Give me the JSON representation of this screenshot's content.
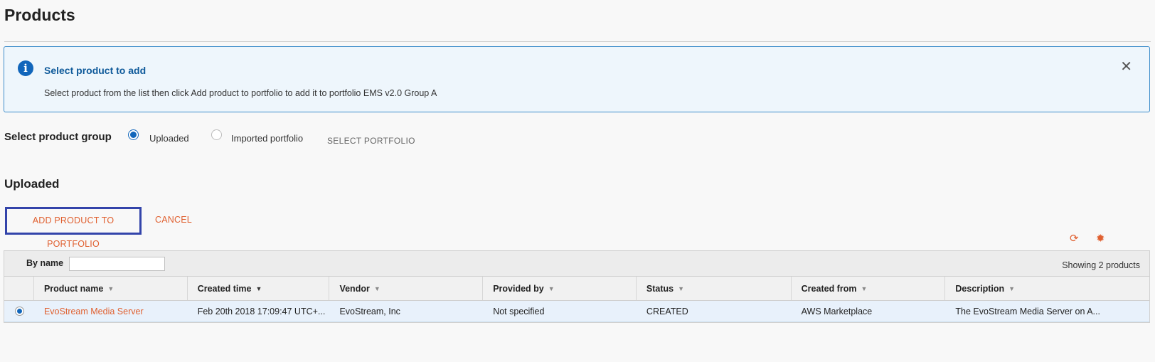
{
  "page": {
    "title": "Products"
  },
  "info": {
    "title": "Select product to add",
    "text": "Select product from the list then click Add product to portfolio to add it to portfolio EMS v2.0 Group A",
    "icon": "info-icon",
    "close_icon": "close-icon"
  },
  "product_group": {
    "label": "Select product group",
    "options": [
      {
        "label": "Uploaded",
        "selected": true
      },
      {
        "label": "Imported portfolio",
        "selected": false
      }
    ],
    "select_portfolio_label": "SELECT PORTFOLIO"
  },
  "section": {
    "title": "Uploaded"
  },
  "actions": {
    "add_label": "ADD PRODUCT TO PORTFOLIO",
    "cancel_label": "CANCEL"
  },
  "toolbar": {
    "refresh_icon": "refresh-icon",
    "settings_icon": "gear-icon"
  },
  "table": {
    "filter_label": "By name",
    "filter_value": "",
    "showing": "Showing 2 products",
    "columns": [
      "Product name",
      "Created time",
      "Vendor",
      "Provided by",
      "Status",
      "Created from",
      "Description"
    ],
    "rows": [
      {
        "selected": true,
        "product_name": "EvoStream Media Server",
        "created_time": "Feb 20th 2018 17:09:47 UTC+...",
        "vendor": "EvoStream, Inc",
        "provided_by": "Not specified",
        "status": "CREATED",
        "created_from": "AWS Marketplace",
        "description": "The EvoStream Media Server on A..."
      }
    ]
  },
  "colors": {
    "accent": "#e06030",
    "info_border": "#3e8dcb",
    "info_bg": "#eef6fc",
    "selection": "#1166bb"
  }
}
